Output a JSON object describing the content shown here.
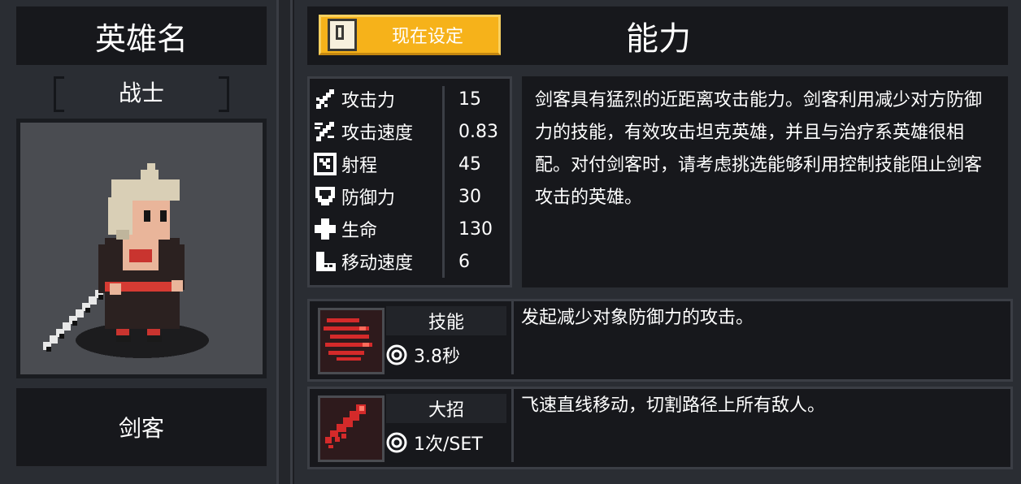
{
  "hero": {
    "name_header": "英雄名",
    "class_label": "战士",
    "type_label": "剑客"
  },
  "top": {
    "set_button_label": "现在设定",
    "ability_title": "能力"
  },
  "stats": [
    {
      "label": "攻击力",
      "value": "15",
      "icon": "sword-icon"
    },
    {
      "label": "攻击速度",
      "value": "0.83",
      "icon": "attack-speed-icon"
    },
    {
      "label": "射程",
      "value": "45",
      "icon": "range-icon"
    },
    {
      "label": "防御力",
      "value": "30",
      "icon": "shield-icon"
    },
    {
      "label": "生命",
      "value": "130",
      "icon": "health-cross-icon"
    },
    {
      "label": "移动速度",
      "value": "6",
      "icon": "boot-icon"
    }
  ],
  "description": "剑客具有猛烈的近距离攻击能力。剑客利用减少对方防御力的技能，有效攻击坦克英雄，并且与治疗系英雄很相配。对付剑客时，请考虑挑选能够利用控制技能阻止剑客攻击的英雄。",
  "skills": [
    {
      "name": "技能",
      "cooldown": "3.8秒",
      "desc": "发起减少对象防御力的攻击。",
      "icon": "slash-lines-icon"
    },
    {
      "name": "大招",
      "cooldown": "1次/SET",
      "desc": "飞速直线移动，切割路径上所有敌人。",
      "icon": "dash-strike-icon"
    }
  ],
  "colors": {
    "button_yellow": "#f6b21a",
    "panel_dark": "#17181c",
    "panel_mid": "#2a2d33",
    "skill_red": "#d42a2a"
  }
}
